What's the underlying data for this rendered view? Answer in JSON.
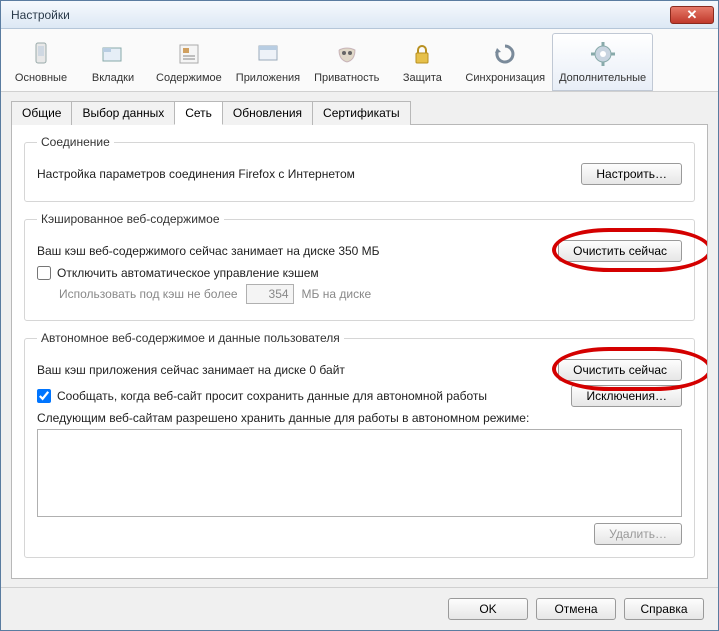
{
  "window": {
    "title": "Настройки"
  },
  "toolbar": {
    "items": [
      {
        "label": "Основные"
      },
      {
        "label": "Вкладки"
      },
      {
        "label": "Содержимое"
      },
      {
        "label": "Приложения"
      },
      {
        "label": "Приватность"
      },
      {
        "label": "Защита"
      },
      {
        "label": "Синхронизация"
      },
      {
        "label": "Дополнительные"
      }
    ],
    "active_index": 7
  },
  "tabs": {
    "items": [
      "Общие",
      "Выбор данных",
      "Сеть",
      "Обновления",
      "Сертификаты"
    ],
    "selected_index": 2
  },
  "connection": {
    "legend": "Соединение",
    "text": "Настройка параметров соединения Firefox с Интернетом",
    "button": "Настроить…"
  },
  "cache": {
    "legend": "Кэшированное веб-содержимое",
    "usage_text": "Ваш кэш веб-содержимого сейчас занимает на диске 350 МБ",
    "clear_button": "Очистить сейчас",
    "override_checkbox": "Отключить автоматическое управление кэшем",
    "limit_prefix": "Использовать под кэш не более",
    "limit_value": "354",
    "limit_suffix": "МБ на диске"
  },
  "offline": {
    "legend": "Автономное веб-содержимое и данные пользователя",
    "usage_text": "Ваш кэш приложения сейчас занимает на диске 0 байт",
    "clear_button": "Очистить сейчас",
    "notify_checkbox": "Сообщать, когда веб-сайт просит сохранить данные для автономной работы",
    "notify_checked": true,
    "exceptions_button": "Исключения…",
    "allowed_text": "Следующим веб-сайтам разрешено хранить данные для работы в автономном режиме:",
    "delete_button": "Удалить…"
  },
  "dialog": {
    "ok": "OK",
    "cancel": "Отмена",
    "help": "Справка"
  }
}
